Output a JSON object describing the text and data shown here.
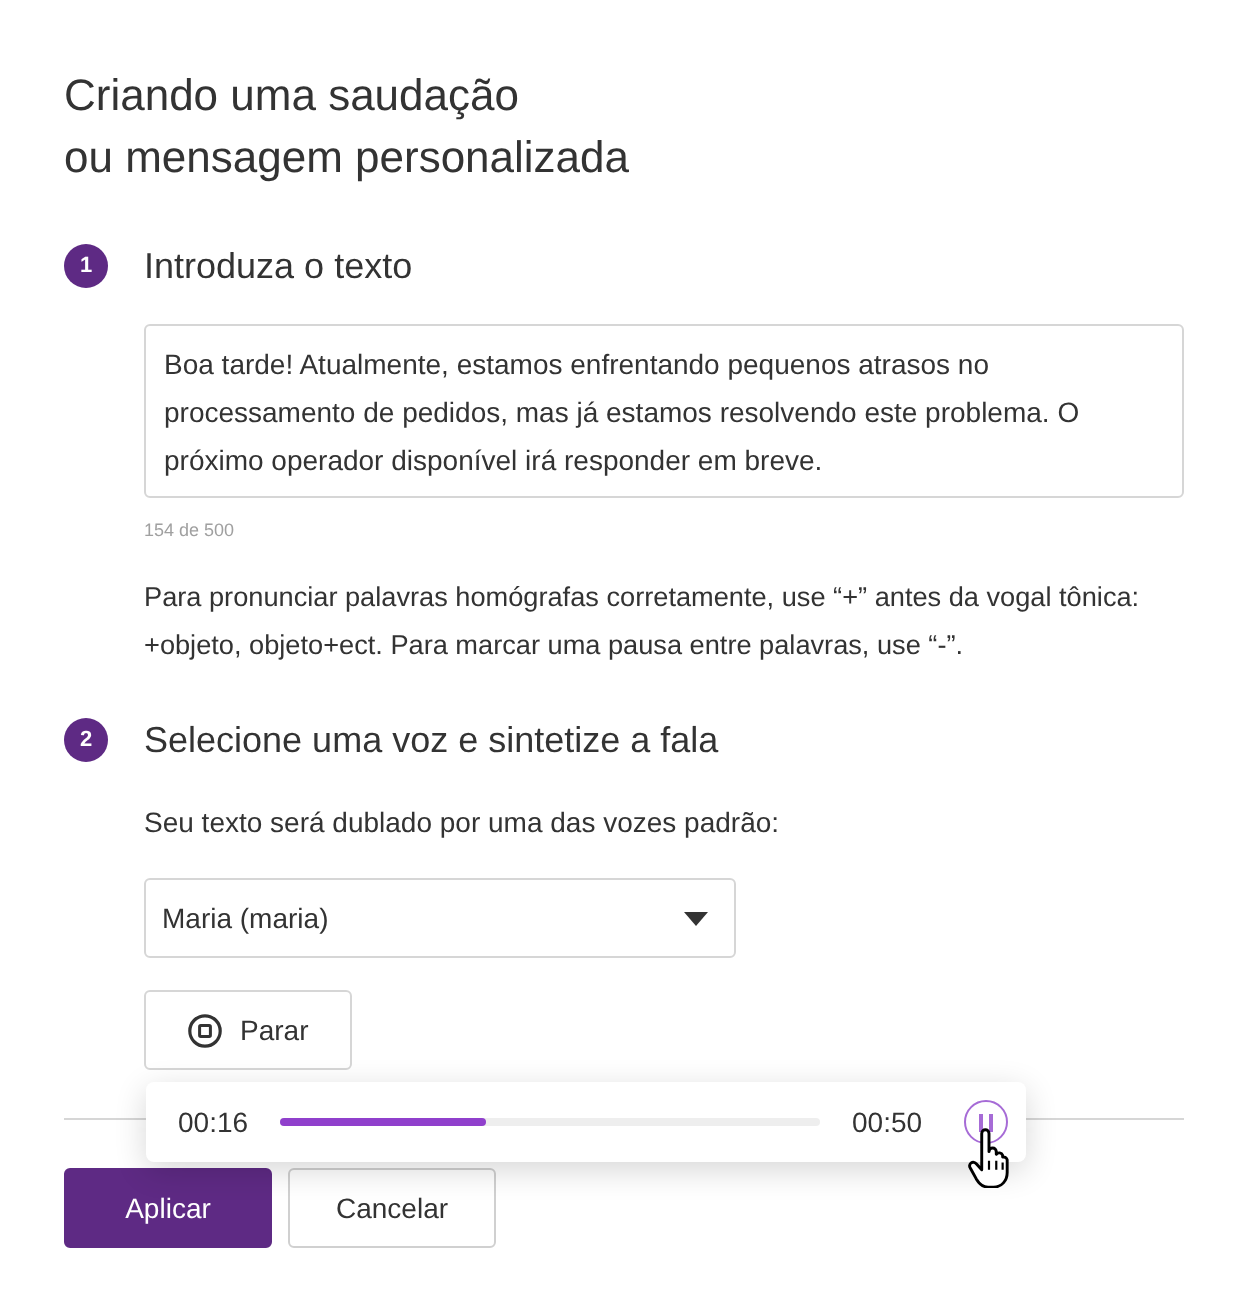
{
  "title_lines": [
    "Criando uma saudação",
    "ou mensagem personalizada"
  ],
  "steps": [
    {
      "number": "1",
      "heading": "Introduza o texto"
    },
    {
      "number": "2",
      "heading": "Selecione uma voz e sintetize a fala"
    }
  ],
  "text_input": {
    "value": "Boa tarde! Atualmente, estamos enfrentando pequenos atrasos no processamento de pedidos, mas já estamos resolvendo este problema. O próximo operador disponível irá responder em breve.",
    "counter": "154 de 500"
  },
  "hint": "Para pronunciar palavras homógrafas corretamente, use “+” antes da vogal tônica: +objeto, objeto+ect. Para marcar uma pausa entre palavras, use “-”.",
  "voice_prompt": "Seu texto será dublado por uma das vozes padrão:",
  "voice_select": {
    "value": "Maria (maria)"
  },
  "stop_button": {
    "label": "Parar"
  },
  "player": {
    "elapsed": "00:16",
    "total": "00:50",
    "level": 0.38,
    "playing": true
  },
  "buttons": [
    {
      "label": "Aplicar",
      "kind": "primary"
    },
    {
      "label": "Cancelar",
      "kind": "secondary"
    }
  ]
}
